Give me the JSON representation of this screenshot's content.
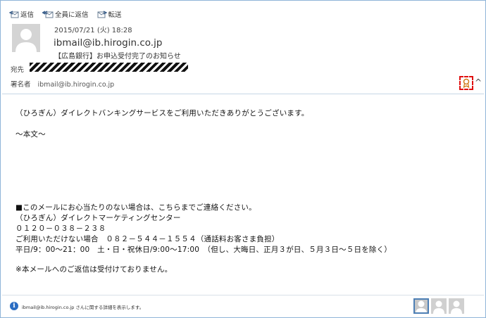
{
  "toolbar": {
    "reply_label": "返信",
    "reply_all_label": "全員に返信",
    "forward_label": "転送"
  },
  "message": {
    "datetime": "2015/07/21 (火) 18:28",
    "from": "ibmail@ib.hirogin.co.jp",
    "subject": "【広島銀行】お申込受付完了のお知らせ",
    "to_label": "宛先",
    "signer_label": "署名者",
    "signer_value": "ibmail@ib.hirogin.co.jp"
  },
  "body": {
    "line1": "（ひろぎん）ダイレクトバンキングサービスをご利用いただきありがとうございます。",
    "line2": "～本文～",
    "line3": "■このメールにお心当たりのない場合は、こちらまでご連絡ください。",
    "line4": "（ひろぎん）ダイレクトマーケティングセンター",
    "line5": "０１２０－０３８－２３８",
    "line6": "ご利用いただけない場合　０８２－５４４－１５５４（通話料お客さま負担）",
    "line7": "平日/9：00～21：00　土・日・祝休日/9:00～17:00　（但し、大晦日、正月３が日、５月３日～５日を除く）",
    "line8": "※本メールへのご返信は受付けておりません。"
  },
  "footer": {
    "info_text": "ibmail@ib.hirogin.co.jp さんに関する詳細を表示します。"
  },
  "colors": {
    "accent": "#2a6cc2",
    "cert_border": "#e01010",
    "frame_border": "#8fb4d8"
  },
  "icons": {
    "reply": "reply-icon",
    "reply_all": "reply-all-icon",
    "forward": "forward-icon",
    "certificate": "certificate-icon",
    "info": "info-icon",
    "collapse": "chevron-up-icon"
  }
}
